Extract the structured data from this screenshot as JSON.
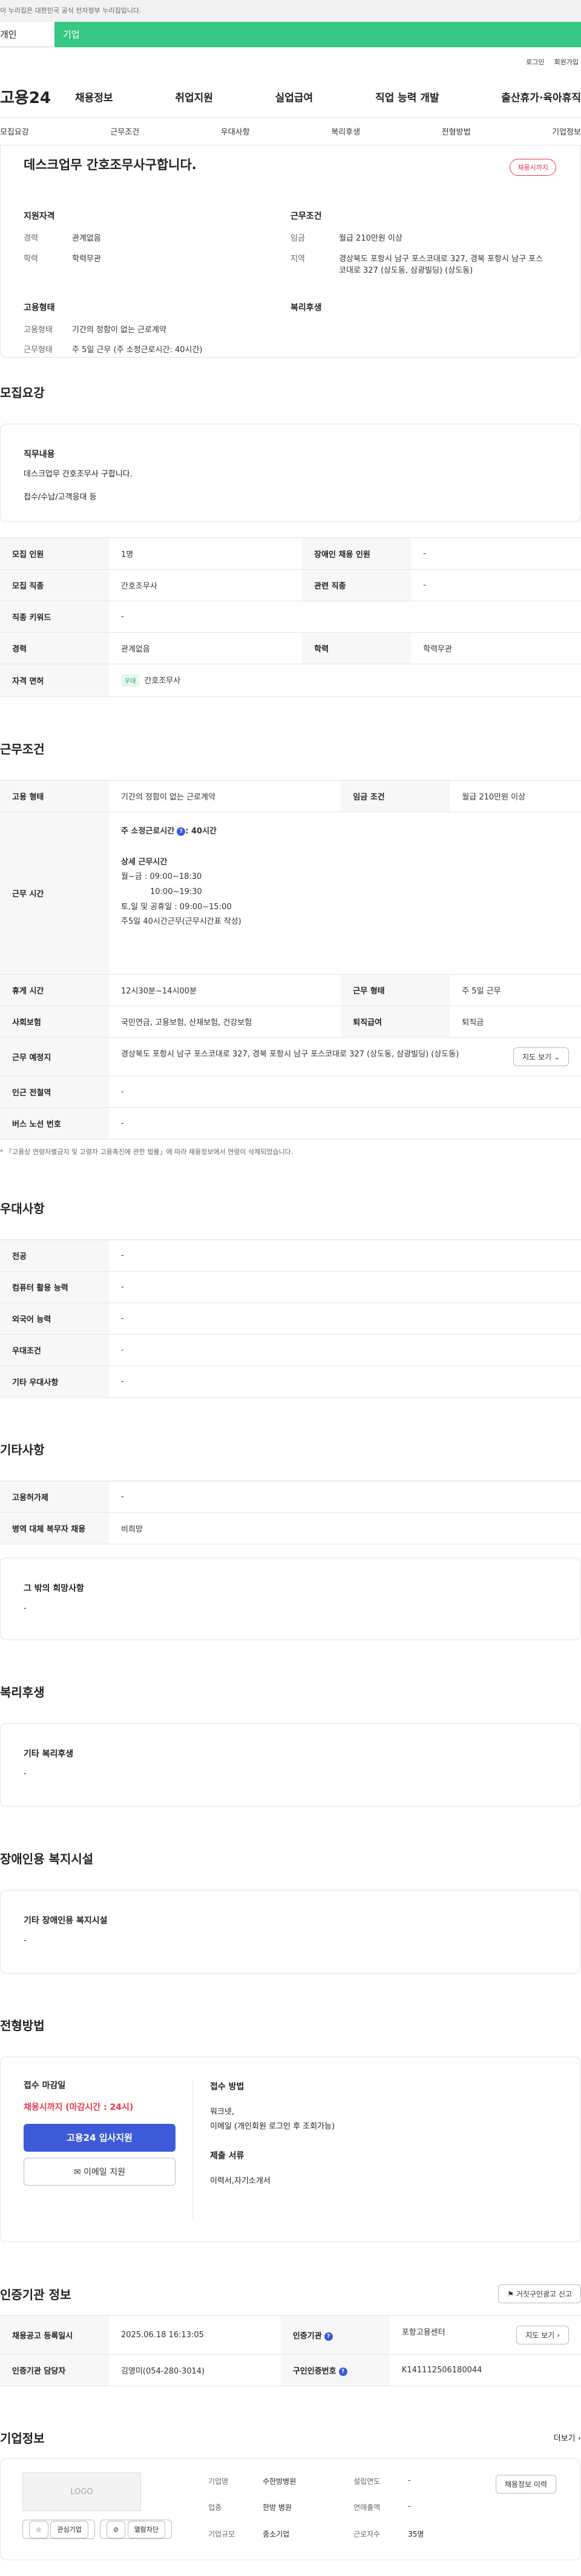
{
  "topbar": {
    "text": "이 누리집은 대한민국 공식 전자정부 누리집입니다."
  },
  "segment": {
    "left": "개인",
    "right": "기업"
  },
  "util": {
    "login": "로그인",
    "join": "회원가입"
  },
  "gnb": {
    "logo": "고용24",
    "menu": [
      "채용정보",
      "취업지원",
      "실업급여",
      "직업 능력 개발",
      "출산휴가·육아휴직"
    ]
  },
  "subnav": [
    "모집요강",
    "근무조건",
    "우대사항",
    "복리후생",
    "전형방법",
    "기업정보"
  ],
  "summary": {
    "title": "데스크업무 간호조무사구합니다.",
    "badge": "채용시까지",
    "qual_title": "지원자격",
    "qual": [
      {
        "k": "경력",
        "v": "관계없음"
      },
      {
        "k": "학력",
        "v": "학력무관"
      }
    ],
    "cond_title": "근무조건",
    "cond": [
      {
        "k": "임금",
        "v": "월급 210만원 이상"
      },
      {
        "k": "지역",
        "v": "경상북도 포항시 남구 포스코대로 327, 경북 포항시 남구 포스코대로 327 (상도동, 삼광빌딩) (상도동)"
      }
    ],
    "emp_title": "고용형태",
    "emp": [
      {
        "k": "고용형태",
        "v": "기간의 정함이 없는 근로계약"
      },
      {
        "k": "근무형태",
        "v": "주 5일 근무 (주 소정근로시간: 40시간)"
      }
    ],
    "welfare_title": "복리후생"
  },
  "recruit": {
    "title": "모집요강",
    "job_title": "직무내용",
    "job_lines": [
      "데스크업무 간호조무사 구합니다.",
      "접수/수납/고객응대 등"
    ],
    "rows": [
      {
        "k1": "모집 인원",
        "v1": "1명",
        "k2": "장애인 채용 인원",
        "v2": "-"
      },
      {
        "k1": "모집 직종",
        "v1": "간호조무사",
        "k2": "관련 직종",
        "v2": "-"
      },
      {
        "k1": "직종 키워드",
        "v1": "-"
      },
      {
        "k1": "경력",
        "v1": "관계없음",
        "k2": "학력",
        "v2": "학력무관"
      },
      {
        "k1": "자격 면허",
        "tag": "우대",
        "v1": "간호조무사"
      }
    ]
  },
  "work": {
    "title": "근무조건",
    "r1": {
      "k1": "고용 형태",
      "v1": "기간의 정함이 없는 근로계약",
      "k2": "임금 조건",
      "v2": "월급 210만원 이상"
    },
    "hours": {
      "k": "근무 시간",
      "weekly": "주 소정근로시간",
      "weekly_val": ": 40시간",
      "detail_title": "상세 근무시간",
      "l1": "월~금 : 09:00~18:30",
      "l2": "10:00~19:30",
      "l3": "토,일 및 공휴일 : 09:00~15:00",
      "l4": "주5일 40시간근무(근무시간표 작성)"
    },
    "r3": {
      "k1": "휴게 시간",
      "v1": "12시30분~14시00분",
      "k2": "근무 형태",
      "v2": "주 5일 근무"
    },
    "r4": {
      "k1": "사회보험",
      "v1": "국민연금, 고용보험, 산재보험, 건강보험",
      "k2": "퇴직급여",
      "v2": "퇴직금"
    },
    "r5": {
      "k1": "근무 예정지",
      "v1": "경상북도 포항시 남구 포스코대로 327, 경북 포항시 남구 포스코대로 327 (상도동, 삼광빌딩) (상도동)",
      "btn": "지도 보기"
    },
    "r6": {
      "k1": "인근 전철역",
      "v1": "-"
    },
    "r7": {
      "k1": "버스 노선 번호",
      "v1": "-"
    },
    "note": "* 「고용상 연령차별금지 및 고령자 고용촉진에 관한 법률」에 따라 채용정보에서 연령이 삭제되었습니다."
  },
  "pref": {
    "title": "우대사항",
    "rows": [
      {
        "k": "전공",
        "v": "-"
      },
      {
        "k": "컴퓨터 활용 능력",
        "v": "-"
      },
      {
        "k": "외국어 능력",
        "v": "-"
      },
      {
        "k": "우대조건",
        "v": "-"
      },
      {
        "k": "기타 우대사항",
        "v": "-"
      }
    ]
  },
  "etc": {
    "title": "기타사항",
    "rows": [
      {
        "k": "고용허가제",
        "v": "-"
      },
      {
        "k": "병역 대체 복무자 채용",
        "v": "비희망"
      }
    ],
    "box_title": "그 밖의 희망사항",
    "box_val": "-"
  },
  "welfare": {
    "title": "복리후생",
    "box_title": "기타 복리후생",
    "box_val": "-"
  },
  "disabled": {
    "title": "장애인용 복지시설",
    "box_title": "기타 장애인용 복지시설",
    "box_val": "-"
  },
  "process": {
    "title": "전형방법",
    "deadline_title": "접수 마감일",
    "deadline": "채용시까지 (마감시간 : 24시)",
    "apply_btn": "고용24 입사지원",
    "email_btn": "이메일 지원",
    "method_title": "접수 방법",
    "method_l1": "워크넷,",
    "method_l2": "이메일 (개인회원 로그인 후 조회가능)",
    "docs_title": "제출 서류",
    "docs": "이력서,자기소개서"
  },
  "agency": {
    "title": "인증기관 정보",
    "report_btn": "거짓구인광고 신고",
    "r1": {
      "k1": "채용공고 등록일시",
      "v1": "2025.06.18 16:13:05",
      "k2": "인증기관",
      "v2": "포항고용센터",
      "btn": "지도 보기"
    },
    "r2": {
      "k1": "인증기관 담당자",
      "v1": "김영미(054-280-3014)",
      "k2": "구인인증번호",
      "v2": "K141112506180044"
    }
  },
  "company": {
    "title": "기업정보",
    "more": "더보기",
    "logo": "LOGO",
    "fav": "관심기업",
    "block": "열람차단",
    "history_btn": "채용정보 이력",
    "name_k": "기업명",
    "name_v": "수한방병원",
    "est_k": "설립연도",
    "est_v": "-",
    "ind_k": "업종",
    "ind_v": "한방 병원",
    "sales_k": "연매출액",
    "sales_v": "-",
    "size_k": "기업규모",
    "size_v": "중소기업",
    "emp_k": "근로자수",
    "emp_v": "35명"
  }
}
